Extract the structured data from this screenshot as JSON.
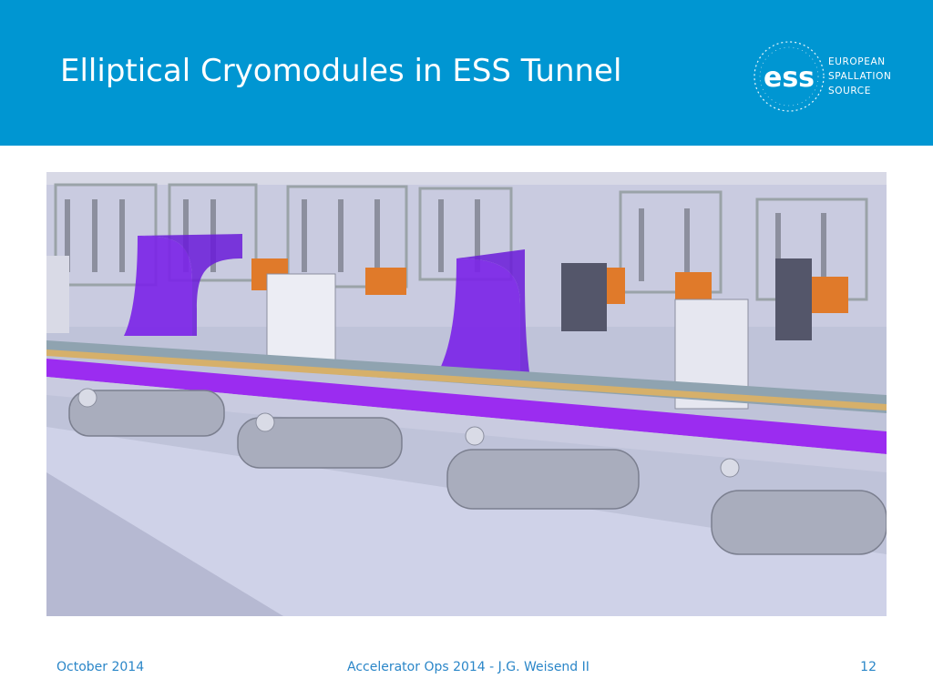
{
  "header": {
    "title": "Elliptical Cryomodules in ESS Tunnel",
    "background_color": "#0096d2"
  },
  "logo": {
    "mark": "ess",
    "lines": [
      "EUROPEAN",
      "SPALLATION",
      "SOURCE"
    ]
  },
  "footer": {
    "date": "October 2014",
    "center": "Accelerator Ops 2014 - J.G. Weisend II",
    "page_number": "12",
    "text_color": "#2a86c8"
  }
}
